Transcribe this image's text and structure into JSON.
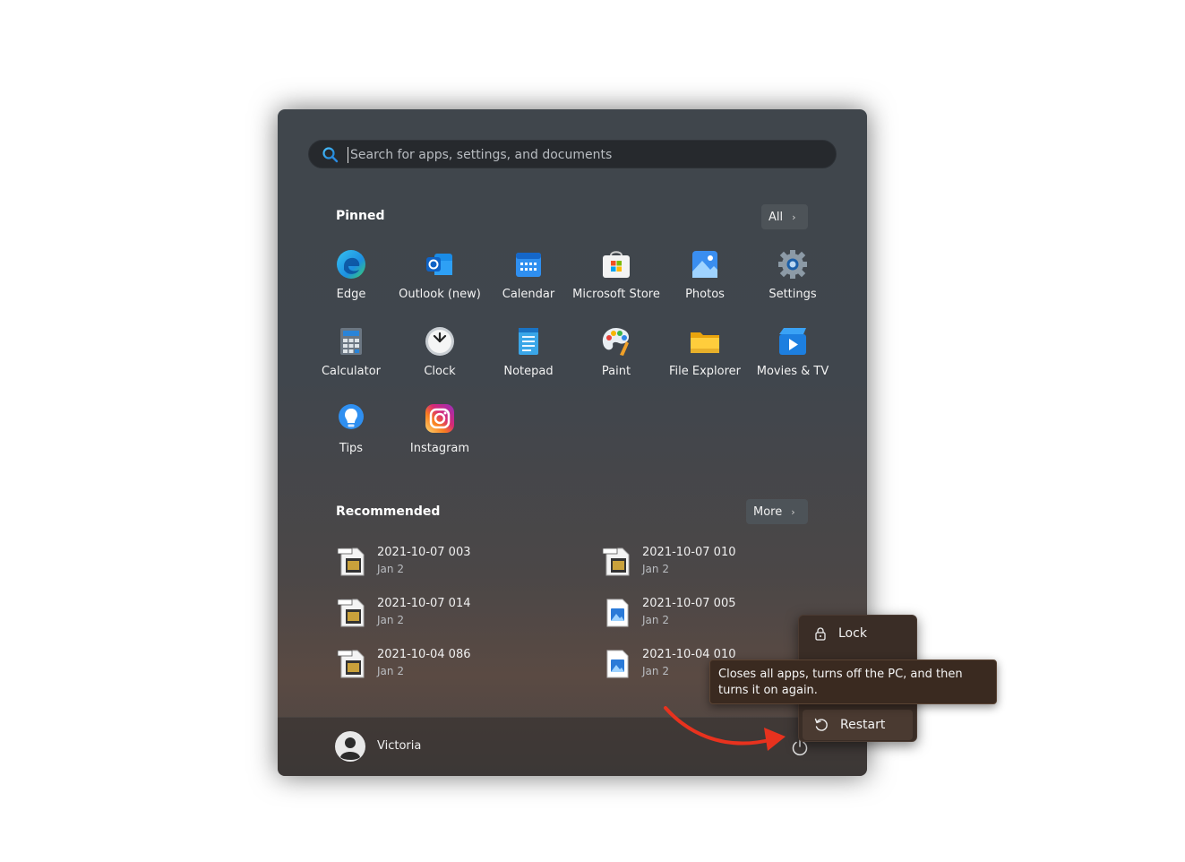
{
  "search": {
    "placeholder": "Search for apps, settings, and documents"
  },
  "pinned": {
    "title": "Pinned",
    "all_label": "All",
    "apps": [
      {
        "label": "Edge",
        "icon": "edge-icon"
      },
      {
        "label": "Outlook (new)",
        "icon": "outlook-icon"
      },
      {
        "label": "Calendar",
        "icon": "calendar-icon"
      },
      {
        "label": "Microsoft Store",
        "icon": "store-icon"
      },
      {
        "label": "Photos",
        "icon": "photos-icon"
      },
      {
        "label": "Settings",
        "icon": "gear-icon"
      },
      {
        "label": "Calculator",
        "icon": "calculator-icon"
      },
      {
        "label": "Clock",
        "icon": "clock-icon"
      },
      {
        "label": "Notepad",
        "icon": "notepad-icon"
      },
      {
        "label": "Paint",
        "icon": "paint-icon"
      },
      {
        "label": "File Explorer",
        "icon": "folder-icon"
      },
      {
        "label": "Movies & TV",
        "icon": "movies-icon"
      },
      {
        "label": "Tips",
        "icon": "lightbulb-icon"
      },
      {
        "label": "Instagram",
        "icon": "instagram-icon"
      }
    ]
  },
  "recommended": {
    "title": "Recommended",
    "more_label": "More",
    "items": [
      {
        "name": "2021-10-07 003",
        "date": "Jan 2",
        "icon": "movie-file-icon"
      },
      {
        "name": "2021-10-07 010",
        "date": "Jan 2",
        "icon": "movie-file-icon"
      },
      {
        "name": "2021-10-07 014",
        "date": "Jan 2",
        "icon": "movie-file-icon"
      },
      {
        "name": "2021-10-07 005",
        "date": "Jan 2",
        "icon": "image-file-icon"
      },
      {
        "name": "2021-10-04 086",
        "date": "Jan 2",
        "icon": "movie-file-icon"
      },
      {
        "name": "2021-10-04 010",
        "date": "Jan 2",
        "icon": "image-file-icon"
      }
    ]
  },
  "user": {
    "name": "Victoria"
  },
  "power_menu": {
    "lock_label": "Lock",
    "restart_label": "Restart"
  },
  "tooltip": {
    "text": "Closes all apps, turns off the PC, and then turns it on again."
  },
  "colors": {
    "arrow": "#e8321e",
    "accent": "#0078d4"
  }
}
